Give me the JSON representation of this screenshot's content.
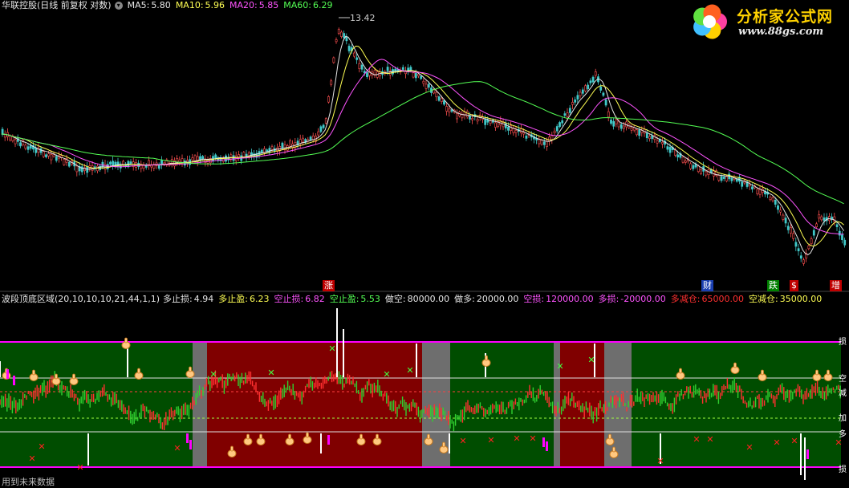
{
  "main_header": {
    "title": "华联控股(日线 前复权 对数)",
    "ma": [
      {
        "label": "MA5:",
        "value": "5.80",
        "color": "#e6e6e6"
      },
      {
        "label": "MA10:",
        "value": "5.96",
        "color": "#ffff54"
      },
      {
        "label": "MA20:",
        "value": "5.85",
        "color": "#ff54ff"
      },
      {
        "label": "MA60:",
        "value": "6.29",
        "color": "#54ff54"
      }
    ]
  },
  "peak_label": "13.42",
  "logo": {
    "text": "分析家公式网",
    "url": "www.88gs.com"
  },
  "events": [
    {
      "label": "涨",
      "bg": "#c00000"
    },
    {
      "label": "财",
      "bg": "#1a3fb0"
    },
    {
      "label": "跌",
      "bg": "#008000"
    },
    {
      "label": "$",
      "bg": "#c00000"
    },
    {
      "label": "增",
      "bg": "#c00000"
    }
  ],
  "sub_header": {
    "title": "波段顶底区域(20,10,10,10,21,44,1,1)",
    "items": [
      {
        "label": "多止损:",
        "value": "4.94",
        "color": "#e6e6e6"
      },
      {
        "label": "多止盈:",
        "value": "6.23",
        "color": "#ffff54"
      },
      {
        "label": "空止损:",
        "value": "6.82",
        "color": "#ff54ff"
      },
      {
        "label": "空止盈:",
        "value": "5.53",
        "color": "#54ff54"
      },
      {
        "label": "做空:",
        "value": "80000.00",
        "color": "#e6e6e6"
      },
      {
        "label": "做多:",
        "value": "20000.00",
        "color": "#e6e6e6"
      },
      {
        "label": "空损:",
        "value": "120000.00",
        "color": "#ff54ff"
      },
      {
        "label": "多损:",
        "value": "-20000.00",
        "color": "#ff54ff"
      },
      {
        "label": "多减仓:",
        "value": "65000.00",
        "color": "#ff3030"
      },
      {
        "label": "空减仓:",
        "value": "35000.00",
        "color": "#ffff54"
      }
    ]
  },
  "right_labels": [
    "损",
    "空",
    "减",
    "加",
    "多",
    "损"
  ],
  "bottom_note": "用到未来数据",
  "colors": {
    "background": "#000000",
    "zone_green": "#004d00",
    "zone_red": "#800000",
    "zone_gray": "#6e6e6e",
    "magenta_line": "#ff00ff",
    "up_bar": "#ff3030",
    "down_bar": "#30d030"
  },
  "icons": [
    "info-circle-icon",
    "hand-pointer-icon",
    "cross-mark-icon",
    "x-mark-icon"
  ]
}
